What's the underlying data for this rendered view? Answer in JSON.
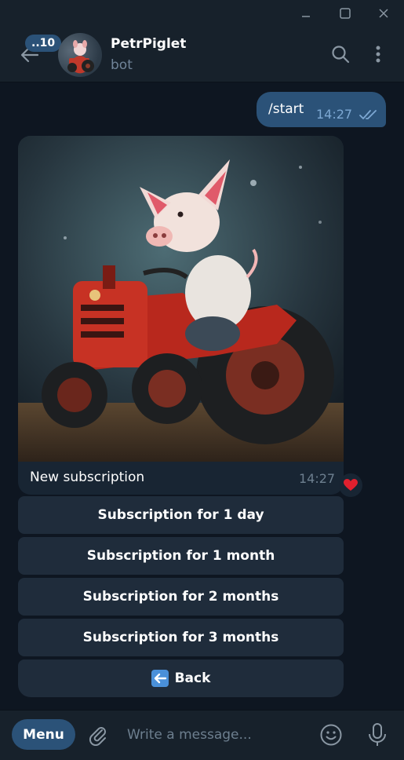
{
  "window": {
    "minimize_icon": "minimize-icon",
    "maximize_icon": "maximize-icon",
    "close_icon": "close-icon"
  },
  "header": {
    "unread_count": "..10",
    "title": "PetrPiglet",
    "subtitle": "bot",
    "icons": [
      "back-arrow-icon",
      "search-icon",
      "more-vertical-icon"
    ]
  },
  "messages": {
    "outgoing": {
      "text": "/start",
      "time": "14:27",
      "status_icon": "double-check-icon"
    },
    "incoming": {
      "caption": "New subscription",
      "time": "14:27",
      "reaction": "heart-icon"
    }
  },
  "keyboard": {
    "buttons": [
      {
        "label": "Subscription for 1 day"
      },
      {
        "label": "Subscription for 1 month"
      },
      {
        "label": "Subscription for 2 months"
      },
      {
        "label": "Subscription for 3 months"
      },
      {
        "label": "Back",
        "icon": "back-emoji-icon"
      }
    ]
  },
  "composer": {
    "menu_label": "Menu",
    "placeholder": "Write a message...",
    "icons": [
      "attach-icon",
      "emoji-icon",
      "microphone-icon"
    ]
  },
  "colors": {
    "background": "#0e1621",
    "panel": "#17212b",
    "accent": "#2b5278",
    "muted": "#708499"
  }
}
